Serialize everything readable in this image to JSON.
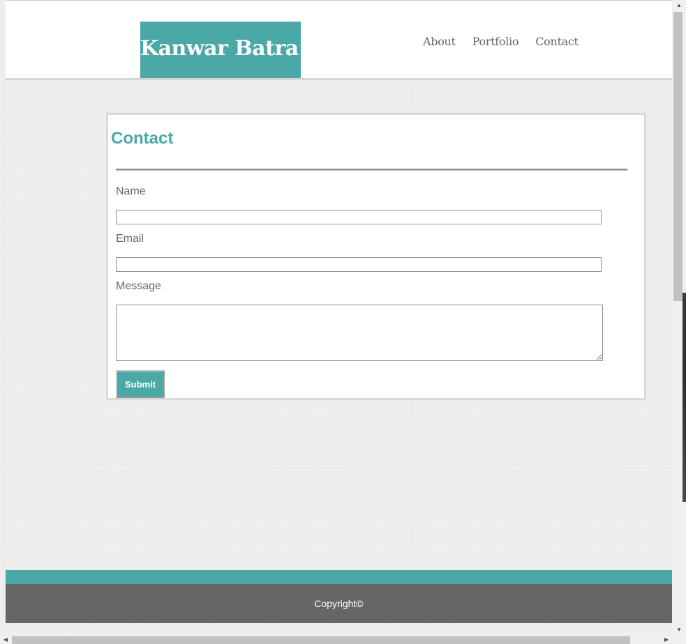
{
  "header": {
    "logo_text": "Kanwar Batra",
    "nav": [
      {
        "label": "About"
      },
      {
        "label": "Portfolio"
      },
      {
        "label": "Contact"
      }
    ]
  },
  "contact": {
    "title": "Contact",
    "name_label": "Name",
    "name_value": "",
    "email_label": "Email",
    "email_value": "",
    "message_label": "Message",
    "message_value": "",
    "submit_label": "Submit"
  },
  "footer": {
    "copyright": "Copyright©"
  },
  "colors": {
    "accent": "#4aa9a6",
    "footer_bg": "#666666",
    "text_muted": "#666666"
  },
  "icons": {
    "scroll_up": "scroll-up-arrow-icon",
    "scroll_down": "scroll-down-arrow-icon",
    "scroll_left": "scroll-left-arrow-icon",
    "scroll_right": "scroll-right-arrow-icon"
  }
}
